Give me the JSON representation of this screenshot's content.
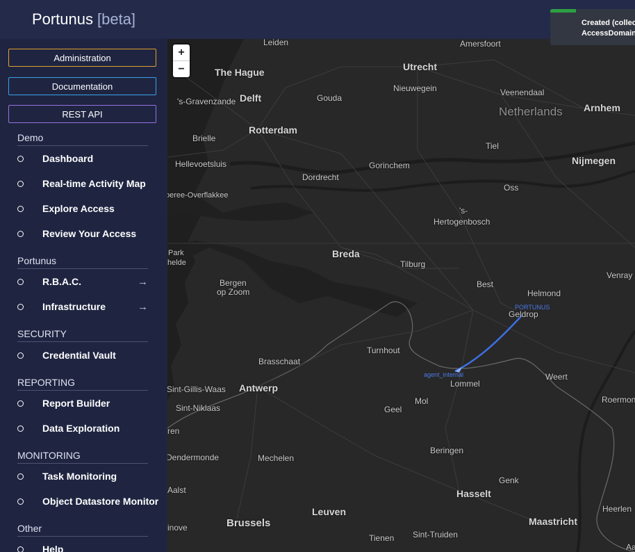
{
  "app": {
    "name": "Portunus",
    "badge": "[beta]"
  },
  "top_buttons": [
    {
      "label": "Administration",
      "color": "#e0a030"
    },
    {
      "label": "Documentation",
      "color": "#3aa0e8"
    },
    {
      "label": "REST API",
      "color": "#9b6fe0"
    }
  ],
  "sections": {
    "demo": "Demo",
    "portunus": "Portunus",
    "security": "SECURITY",
    "reporting": "REPORTING",
    "monitoring": "MONITORING",
    "other": "Other"
  },
  "menu": {
    "dashboard": "Dashboard",
    "activity_map": "Real-time Activity Map",
    "explore_access": "Explore Access",
    "review_access": "Review Your Access",
    "rbac": "R.B.A.C.",
    "infrastructure": "Infrastructure",
    "credential_vault": "Credential Vault",
    "report_builder": "Report Builder",
    "data_exploration": "Data Exploration",
    "task_monitoring": "Task Monitoring",
    "object_datastore": "Object Datastore Monitor",
    "help": "Help"
  },
  "icons": {
    "submenu_arrow": "arrow-right-icon",
    "menu_bullet": "circle-icon"
  },
  "toast": {
    "line1": "Created (collect",
    "line2": "AccessDomain",
    "progress": 0.3,
    "color": "#2ea043"
  },
  "map": {
    "zoom_in": "+",
    "zoom_out": "−",
    "country": "Netherlands",
    "cities": {
      "leiden": "Leiden",
      "amersfoort": "Amersfoort",
      "the_hague": "The Hague",
      "utrecht": "Utrecht",
      "nieuwegein": "Nieuwegein",
      "veenendaal": "Veenendaal",
      "gravenzande": "'s-Gravenzande",
      "delft": "Delft",
      "gouda": "Gouda",
      "arnhem": "Arnhem",
      "rotterdam": "Rotterdam",
      "brielle": "Brielle",
      "tiel": "Tiel",
      "hellevoetsluis": "Hellevoetsluis",
      "gorinchem": "Gorinchem",
      "nijmegen": "Nijmegen",
      "dordrecht": "Dordrecht",
      "oss": "Oss",
      "overflakkee": "oeree-Overflakkee",
      "s": "'s-",
      "hertogenbosch": "Hertogenbosch",
      "park": "Park",
      "helde": "helde",
      "breda": "Breda",
      "tilburg": "Tilburg",
      "best": "Best",
      "helmond": "Helmond",
      "venray": "Venray",
      "bergen": "Bergen",
      "op_zoom": "op Zoom",
      "geldrop": "Geldrop",
      "turnhout": "Turnhout",
      "brasschaat": "Brasschaat",
      "weert": "Weert",
      "sint_gillis": "Sint-Gillis-Waas",
      "antwerp": "Antwerp",
      "lommel": "Lommel",
      "roermond": "Roermon",
      "mol": "Mol",
      "sint_niklaas": "Sint-Niklaas",
      "geel": "Geel",
      "ren": "ren",
      "beringen": "Beringen",
      "dendermonde": "Dendermonde",
      "mechelen": "Mechelen",
      "genk": "Genk",
      "aalst": "Aalst",
      "hasselt": "Hasselt",
      "heerlen": "Heerlen",
      "leuven": "Leuven",
      "brussels": "Brussels",
      "maastricht": "Maastricht",
      "inove": "inove",
      "tienen": "Tienen",
      "sint_truiden": "Sint-Truiden",
      "aa": "Aa"
    },
    "markers": {
      "portunus": "PORTUNUS",
      "agent": "agent_internal"
    }
  }
}
